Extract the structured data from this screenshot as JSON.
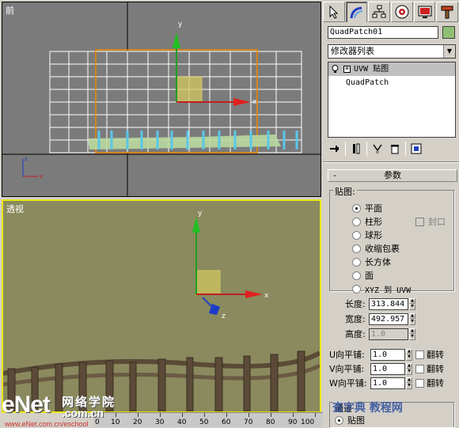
{
  "viewports": {
    "front_label": "前",
    "persp_label": "透视",
    "axis_x": "x",
    "axis_y": "y",
    "axis_z": "z"
  },
  "object_name": "QuadPatch01",
  "object_color": "#8fbf73",
  "modifier_list": "修改器列表",
  "stack": [
    {
      "label": "UVW 贴图",
      "selected": true
    },
    {
      "label": "QuadPatch",
      "selected": false
    }
  ],
  "rollout": {
    "title": "参数",
    "mapping": {
      "group_label": "贴图:",
      "options": [
        "平面",
        "柱形",
        "球形",
        "收缩包裹",
        "长方体",
        "面",
        "XYZ 到 UVW"
      ],
      "selected": "平面",
      "cap_label": "封口"
    },
    "length_label": "长度:",
    "length_value": "313.844",
    "width_label": "宽度:",
    "width_value": "492.957",
    "height_label": "高度:",
    "height_value": "1.0",
    "u_tile_label": "U向平铺:",
    "u_tile_value": "1.0",
    "v_tile_label": "V向平铺:",
    "v_tile_value": "1.0",
    "w_tile_label": "W向平铺:",
    "w_tile_value": "1.0",
    "flip_label": "翻转",
    "channel_label": "通道",
    "channel_option": "贴图"
  },
  "timeline": {
    "ticks": [
      "0",
      "10",
      "20",
      "30",
      "40",
      "50",
      "60",
      "70",
      "80",
      "90",
      "100"
    ]
  },
  "watermark": {
    "logo": "eNet",
    "dot_com": ".com.cn",
    "cn": "网络学院",
    "url": "www.eNet.com.cn/eschool",
    "right": "查字典 教程网"
  }
}
